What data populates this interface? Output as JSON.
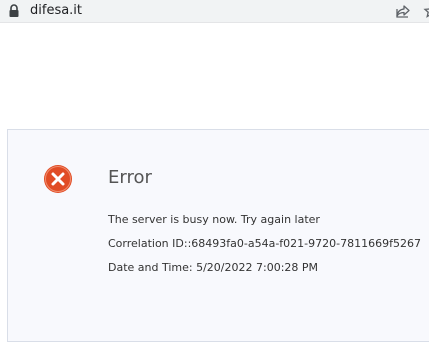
{
  "browser": {
    "url": "difesa.it",
    "icons": {
      "lock": "lock-icon",
      "share": "share-icon",
      "bookmark": "star-icon"
    }
  },
  "error": {
    "icon": "error-x-icon",
    "icon_color": "#e14c25",
    "title": "Error",
    "message": "The server is busy now. Try again later",
    "correlation": "Correlation ID::68493fa0-a54a-f021-9720-7811669f5267",
    "datetime": "Date and Time: 5/20/2022 7:00:28 PM"
  }
}
